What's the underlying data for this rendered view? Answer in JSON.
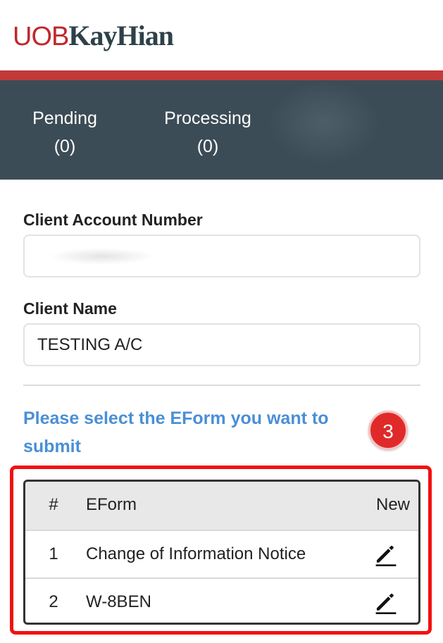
{
  "header": {
    "logo_uob": "UOB",
    "logo_kh": "KayHian"
  },
  "status": {
    "pending_label": "Pending",
    "pending_count": "(0)",
    "processing_label": "Processing",
    "processing_count": "(0)"
  },
  "form": {
    "account_label": "Client Account Number",
    "account_value": "",
    "name_label": "Client Name",
    "name_value": "TESTING A/C"
  },
  "prompt": "Please select the EForm you want to submit",
  "step_badge": "3",
  "table": {
    "headers": [
      "#",
      "EForm",
      "New"
    ],
    "rows": [
      {
        "num": "1",
        "eform": "Change of Information Notice"
      },
      {
        "num": "2",
        "eform": "W-8BEN"
      }
    ]
  },
  "colors": {
    "brand_red": "#c0272d",
    "brand_dark": "#2e4148",
    "status_bar": "#3c4c56",
    "prompt_blue": "#4a8fd6",
    "highlight_red": "#f21010"
  },
  "icons": {
    "edit": "pencil-edit-icon"
  }
}
